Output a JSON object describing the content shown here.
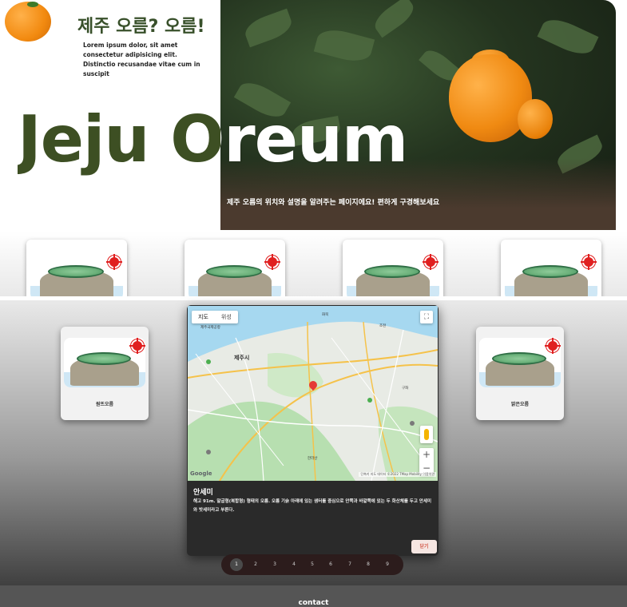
{
  "hero": {
    "title": "제주 오름? 오름!",
    "subtitle": "Lorem ipsum dolor, sit amet consectetur adipisicing elit. Distinctio recusandae vitae cum in suscipit",
    "big_title": "Jeju Oreum",
    "caption": "제주 오름의 위치와 설명을 알려주는 페이지에요! 편하게 구경해보세요"
  },
  "carousel": {
    "cards": [
      {
        "name": "",
        "icon": "oreum-illustration"
      },
      {
        "name": "",
        "icon": "oreum-illustration"
      },
      {
        "name": "",
        "icon": "oreum-illustration"
      },
      {
        "name": "",
        "icon": "oreum-illustration"
      }
    ],
    "side_cards": [
      {
        "name": "원뜨오름"
      },
      {
        "name": "밝은오름"
      }
    ]
  },
  "modal": {
    "map_type_buttons": [
      "지도",
      "위성"
    ],
    "map_labels": [
      "제주시",
      "제주국제공항",
      "화북",
      "조천",
      "구좌",
      "한라산"
    ],
    "map_attribution": "단축키  지도 데이터 ©2022 TMap Mobility  이용약관",
    "google_logo": "Google",
    "title": "안세미",
    "description": "해고 91m. 말굽형(복합형) 형태의 오름. 오름 기슭 아래에 있는 샘터를 중심으로 안쪽과 바깥쪽에 있는 두 화산체를 두고 안세미와 밧세미라고 부른다.",
    "close_label": "닫기"
  },
  "pagination": {
    "pages": [
      "1",
      "2",
      "3",
      "4",
      "5",
      "6",
      "7",
      "8",
      "9"
    ],
    "active": "1"
  },
  "footer": {
    "text": "contact"
  },
  "colors": {
    "title_green": "#3d4f23",
    "orange": "#f08a12",
    "footer_bg": "#555555",
    "close_text": "#d35a4a"
  }
}
